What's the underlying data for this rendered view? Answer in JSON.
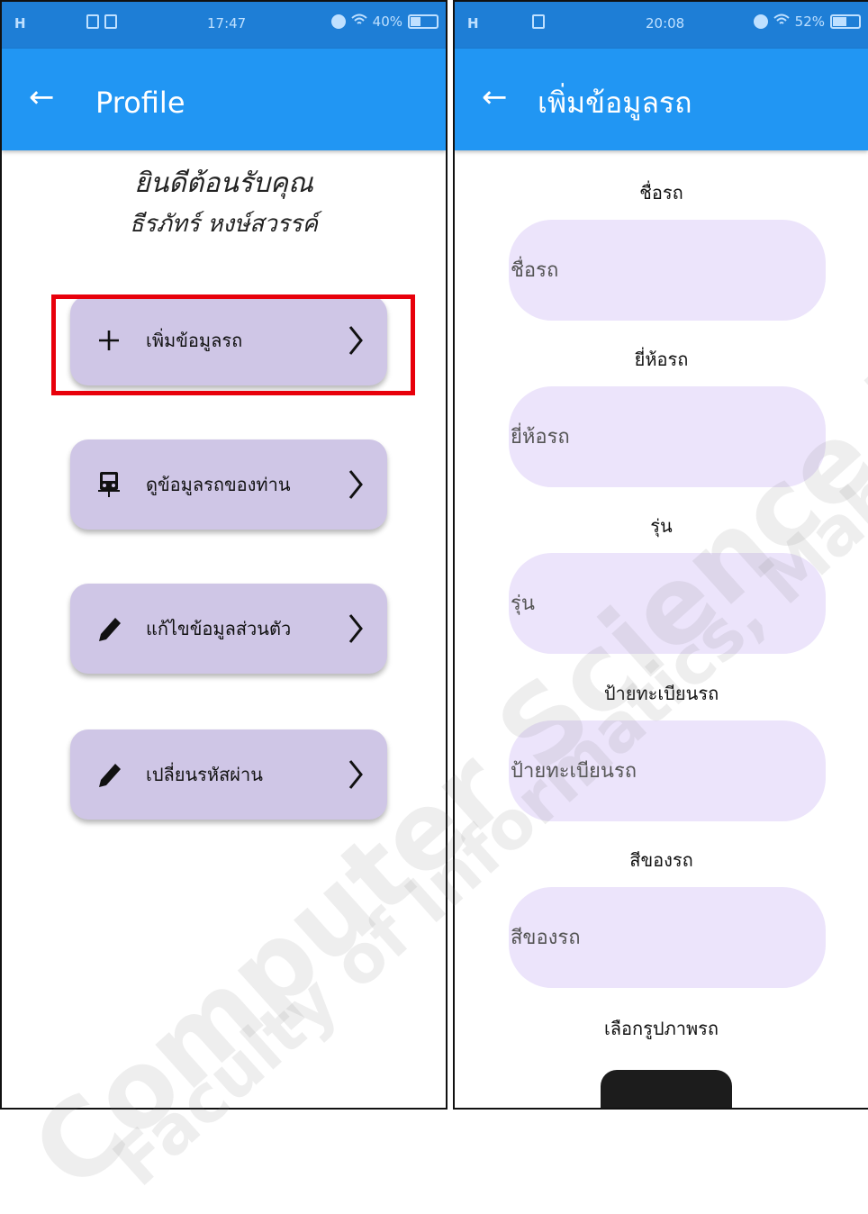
{
  "left_screen": {
    "status": {
      "signal": "H",
      "time": "17:47",
      "battery": "40%",
      "battery_level": 0.4
    },
    "appbar": {
      "title": "Profile"
    },
    "welcome": {
      "line1": "ยินดีต้อนรับคุณ",
      "line2": "ธีรภัทร์ หงษ์สวรรค์"
    },
    "menu": [
      {
        "label": "เพิ่มข้อมูลรถ",
        "icon": "plus-icon"
      },
      {
        "label": "ดูข้อมูลรถของท่าน",
        "icon": "car-icon"
      },
      {
        "label": "แก้ไขข้อมูลส่วนตัว",
        "icon": "pencil-icon"
      },
      {
        "label": "เปลี่ยนรหัสผ่าน",
        "icon": "pencil-icon"
      }
    ]
  },
  "right_screen": {
    "status": {
      "signal": "H",
      "time": "20:08",
      "battery": "52%",
      "battery_level": 0.52
    },
    "appbar": {
      "title": "เพิ่มข้อมูลรถ"
    },
    "fields": [
      {
        "label": "ชื่อรถ",
        "placeholder": "ชื่อรถ"
      },
      {
        "label": "ยี่ห้อรถ",
        "placeholder": "ยี่ห้อรถ"
      },
      {
        "label": "รุ่น",
        "placeholder": "รุ่น"
      },
      {
        "label": "ป้ายทะเบียนรถ",
        "placeholder": "ป้ายทะเบียนรถ"
      },
      {
        "label": "สีของรถ",
        "placeholder": "สีของรถ"
      }
    ],
    "image_label": "เลือกรูปภาพรถ"
  },
  "watermark": {
    "line1": "Computer Science Department",
    "line2": "Faculty of Informatics, Mahasarakham University"
  },
  "colors": {
    "appbar": "#2196f3",
    "statusbar": "#1e7ed6",
    "menu_button": "#cfc6e6",
    "field_bg": "#ece4fb",
    "highlight": "#e8000b"
  }
}
